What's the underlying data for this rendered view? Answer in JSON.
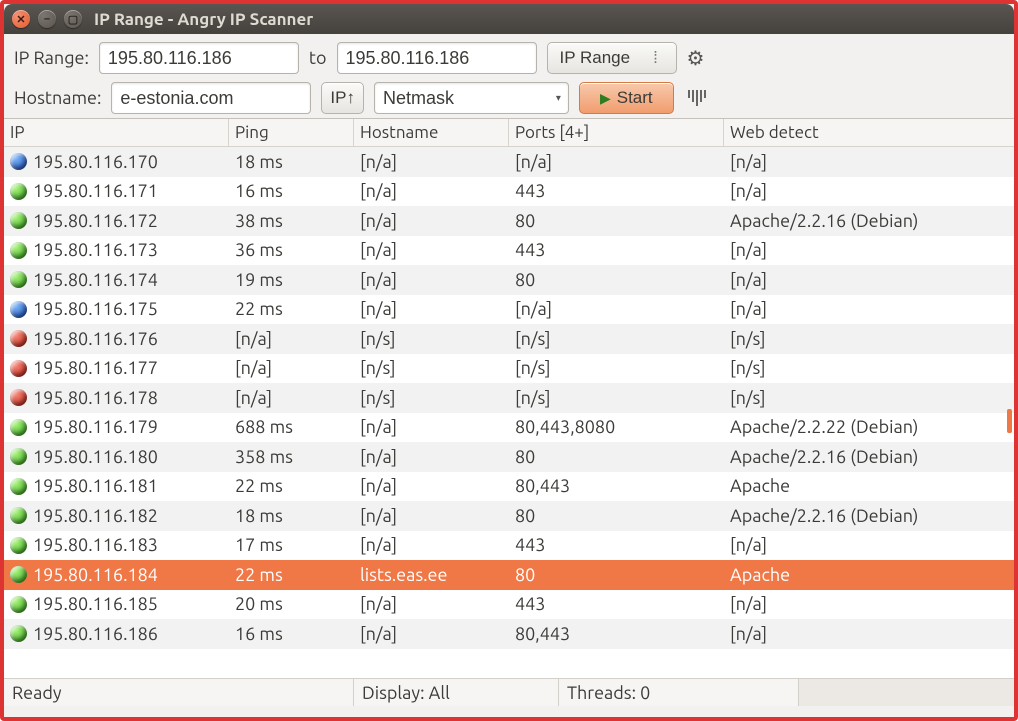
{
  "window": {
    "title": "IP Range - Angry IP Scanner"
  },
  "toolbar": {
    "ip_range_label": "IP Range:",
    "ip_from": "195.80.116.186",
    "to_label": "to",
    "ip_to": "195.80.116.186",
    "range_mode": "IP Range",
    "hostname_label": "Hostname:",
    "hostname": "e-estonia.com",
    "ip_up_label": "IP↑",
    "netmask_label": "Netmask",
    "start_label": "Start"
  },
  "columns": {
    "ip": "IP",
    "ping": "Ping",
    "hostname": "Hostname",
    "ports": "Ports [4+]",
    "web": "Web detect"
  },
  "rows": [
    {
      "status": "blue",
      "ip": "195.80.116.170",
      "ping": "18 ms",
      "hostname": "[n/a]",
      "ports": "[n/a]",
      "web": "[n/a]"
    },
    {
      "status": "green",
      "ip": "195.80.116.171",
      "ping": "16 ms",
      "hostname": "[n/a]",
      "ports": "443",
      "web": "[n/a]"
    },
    {
      "status": "green",
      "ip": "195.80.116.172",
      "ping": "38 ms",
      "hostname": "[n/a]",
      "ports": "80",
      "web": "Apache/2.2.16 (Debian)"
    },
    {
      "status": "green",
      "ip": "195.80.116.173",
      "ping": "36 ms",
      "hostname": "[n/a]",
      "ports": "443",
      "web": "[n/a]"
    },
    {
      "status": "green",
      "ip": "195.80.116.174",
      "ping": "19 ms",
      "hostname": "[n/a]",
      "ports": "80",
      "web": "[n/a]"
    },
    {
      "status": "blue",
      "ip": "195.80.116.175",
      "ping": "22 ms",
      "hostname": "[n/a]",
      "ports": "[n/a]",
      "web": "[n/a]"
    },
    {
      "status": "red",
      "ip": "195.80.116.176",
      "ping": "[n/a]",
      "hostname": "[n/s]",
      "ports": "[n/s]",
      "web": "[n/s]"
    },
    {
      "status": "red",
      "ip": "195.80.116.177",
      "ping": "[n/a]",
      "hostname": "[n/s]",
      "ports": "[n/s]",
      "web": "[n/s]"
    },
    {
      "status": "red",
      "ip": "195.80.116.178",
      "ping": "[n/a]",
      "hostname": "[n/s]",
      "ports": "[n/s]",
      "web": "[n/s]"
    },
    {
      "status": "green",
      "ip": "195.80.116.179",
      "ping": "688 ms",
      "hostname": "[n/a]",
      "ports": "80,443,8080",
      "web": "Apache/2.2.22 (Debian)"
    },
    {
      "status": "green",
      "ip": "195.80.116.180",
      "ping": "358 ms",
      "hostname": "[n/a]",
      "ports": "80",
      "web": "Apache/2.2.16 (Debian)"
    },
    {
      "status": "green",
      "ip": "195.80.116.181",
      "ping": "22 ms",
      "hostname": "[n/a]",
      "ports": "80,443",
      "web": "Apache"
    },
    {
      "status": "green",
      "ip": "195.80.116.182",
      "ping": "18 ms",
      "hostname": "[n/a]",
      "ports": "80",
      "web": "Apache/2.2.16 (Debian)"
    },
    {
      "status": "green",
      "ip": "195.80.116.183",
      "ping": "17 ms",
      "hostname": "[n/a]",
      "ports": "443",
      "web": "[n/a]"
    },
    {
      "status": "green",
      "ip": "195.80.116.184",
      "ping": "22 ms",
      "hostname": "lists.eas.ee",
      "ports": "80",
      "web": "Apache",
      "selected": true
    },
    {
      "status": "green",
      "ip": "195.80.116.185",
      "ping": "20 ms",
      "hostname": "[n/a]",
      "ports": "443",
      "web": "[n/a]"
    },
    {
      "status": "green",
      "ip": "195.80.116.186",
      "ping": "16 ms",
      "hostname": "[n/a]",
      "ports": "80,443",
      "web": "[n/a]"
    }
  ],
  "status": {
    "ready": "Ready",
    "display": "Display: All",
    "threads": "Threads: 0"
  }
}
